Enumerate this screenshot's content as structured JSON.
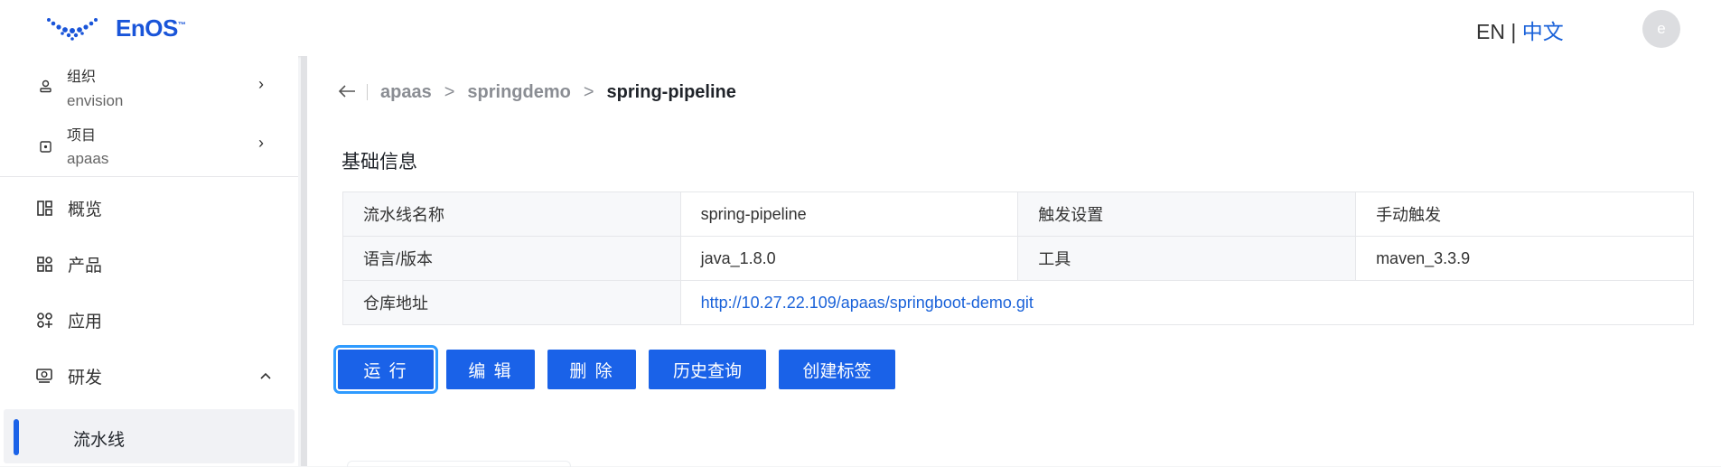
{
  "header": {
    "logo_text": "EnOS",
    "logo_tm": "™",
    "lang_en": "EN",
    "lang_sep": " | ",
    "lang_zh": "中文",
    "avatar_initial": "e"
  },
  "sidebar": {
    "org": {
      "label": "组织",
      "value": "envision"
    },
    "project": {
      "label": "项目",
      "value": "apaas"
    },
    "nav": [
      {
        "label": "概览",
        "icon": "dashboard-icon"
      },
      {
        "label": "产品",
        "icon": "product-icon"
      },
      {
        "label": "应用",
        "icon": "app-icon"
      },
      {
        "label": "研发",
        "icon": "dev-icon",
        "expanded": true
      }
    ],
    "sub": [
      {
        "label": "流水线",
        "selected": true
      }
    ]
  },
  "breadcrumb": {
    "items": [
      "apaas",
      "springdemo"
    ],
    "separator": ">",
    "current": "spring-pipeline"
  },
  "section_title": "基础信息",
  "info_table": {
    "rows": [
      [
        "流水线名称",
        "spring-pipeline",
        "触发设置",
        "手动触发"
      ],
      [
        "语言/版本",
        "java_1.8.0",
        "工具",
        "maven_3.3.9"
      ],
      [
        "仓库地址",
        "http://10.27.22.109/apaas/springboot-demo.git"
      ]
    ]
  },
  "actions": {
    "run": "运 行",
    "edit": "编 辑",
    "delete": "删 除",
    "history": "历史查询",
    "create_tag": "创建标签"
  },
  "colors": {
    "primary": "#1a62e8",
    "focus": "#2f9bff",
    "link": "#1a62d9"
  }
}
